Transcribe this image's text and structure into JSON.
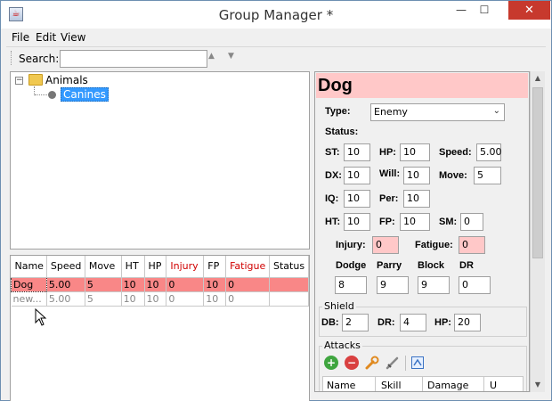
{
  "window": {
    "title": "Group Manager *",
    "min": "—",
    "max": "☐",
    "close": "✕"
  },
  "menu": [
    "File",
    "Edit",
    "View"
  ],
  "toolbar": {
    "search_label": "Search:",
    "search_value": "",
    "prev": "▲",
    "next": "▼"
  },
  "tree": {
    "root": "Animals",
    "child": "Canines",
    "toggle": "−"
  },
  "table": {
    "columns": [
      "Name",
      "Speed",
      "Move",
      "HT",
      "HP",
      "Injury",
      "FP",
      "Fatigue",
      "Status"
    ],
    "rows": [
      [
        "Dog",
        "5.00",
        "5",
        "10",
        "10",
        "0",
        "10",
        "0",
        ""
      ],
      [
        "new...",
        "5.00",
        "5",
        "10",
        "10",
        "0",
        "10",
        "0",
        ""
      ]
    ]
  },
  "sheet": {
    "name": "Dog",
    "type_label": "Type:",
    "type_value": "Enemy",
    "status_label": "Status:",
    "st_label": "ST:",
    "st": "10",
    "hp_label": "HP:",
    "hp": "10",
    "speed_label": "Speed:",
    "speed": "5.00",
    "dx_label": "DX:",
    "dx": "10",
    "will_label": "Will:",
    "will": "10",
    "move_label": "Move:",
    "move": "5",
    "iq_label": "IQ:",
    "iq": "10",
    "per_label": "Per:",
    "per": "10",
    "ht_label": "HT:",
    "ht": "10",
    "fp_label": "FP:",
    "fp": "10",
    "sm_label": "SM:",
    "sm": "0",
    "injury_label": "Injury:",
    "injury": "0",
    "fatigue_label": "Fatigue:",
    "fatigue": "0",
    "dodge_label": "Dodge",
    "dodge": "8",
    "parry_label": "Parry",
    "parry": "9",
    "block_label": "Block",
    "block": "9",
    "dr_label": "DR",
    "dr": "0",
    "shield_title": "Shield",
    "db_label": "DB:",
    "db": "2",
    "shield_dr_label": "DR:",
    "shield_dr": "4",
    "shield_hp_label": "HP:",
    "shield_hp": "20",
    "attacks_title": "Attacks",
    "attack_columns": [
      "Name",
      "Skill",
      "Damage",
      "U"
    ]
  },
  "colors": {
    "selection": "#3399ff",
    "enemy_row": "#f98787",
    "name_banner": "#ffc8c8",
    "close": "#c7392d"
  }
}
